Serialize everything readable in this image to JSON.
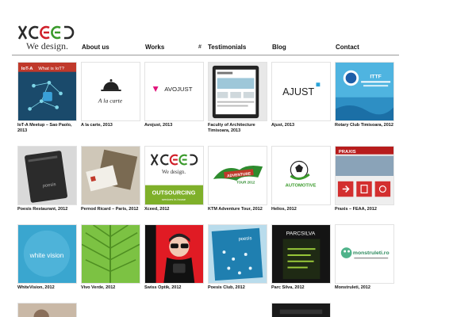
{
  "brand": {
    "logo_text": "XCEED",
    "tagline": "We design."
  },
  "nav": {
    "items": [
      "About us",
      "Works",
      "Testimonials",
      "Blog",
      "Contact"
    ],
    "separator": "#"
  },
  "colors": {
    "accent_green": "#3a9a2b",
    "accent_red": "#d0202a",
    "rule": "#9a9a9a"
  },
  "works": [
    {
      "caption": "IoT-A Meetup – Sao Paolo, 2013",
      "icon": "iot-a-meetup-thumbnail",
      "text": "What is IoT?"
    },
    {
      "caption": "A la carte, 2013",
      "icon": "a-la-carte-thumbnail",
      "text": "A la carte"
    },
    {
      "caption": "Avojust, 2013",
      "icon": "avojust-thumbnail",
      "text": "AVOJUST"
    },
    {
      "caption": "Faculty of Architecture Timisoara, 2013",
      "icon": "faculty-architecture-thumbnail",
      "text": ""
    },
    {
      "caption": "Ajust, 2013",
      "icon": "ajust-thumbnail",
      "text": "AJUST"
    },
    {
      "caption": "Rotary Club Timisoara, 2012",
      "icon": "rotary-club-thumbnail",
      "text": "ITTF"
    },
    {
      "caption": "Poesis Restaurant, 2012",
      "icon": "poesis-restaurant-thumbnail",
      "text": ""
    },
    {
      "caption": "Pernod Ricard – Paris, 2012",
      "icon": "pernod-ricard-thumbnail",
      "text": ""
    },
    {
      "caption": "Xceed, 2012",
      "icon": "xceed-thumbnail",
      "text": "OUTSOURCING"
    },
    {
      "caption": "KTM Adventure Tour, 2012",
      "icon": "ktm-adventure-thumbnail",
      "text": ""
    },
    {
      "caption": "Helios, 2012",
      "icon": "helios-thumbnail",
      "text": "AUTOMOTIVE"
    },
    {
      "caption": "Praxis – FEAA, 2012",
      "icon": "praxis-thumbnail",
      "text": "PRAXIS"
    },
    {
      "caption": "WhiteVision, 2012",
      "icon": "whitevision-thumbnail",
      "text": "white vision"
    },
    {
      "caption": "Vivo Verde, 2012",
      "icon": "vivo-verde-thumbnail",
      "text": ""
    },
    {
      "caption": "Swiss Optik, 2012",
      "icon": "swiss-optik-thumbnail",
      "text": ""
    },
    {
      "caption": "Poesis Club, 2012",
      "icon": "poesis-club-thumbnail",
      "text": ""
    },
    {
      "caption": "Parc Silva, 2012",
      "icon": "parc-silva-thumbnail",
      "text": "PARCSILVA"
    },
    {
      "caption": "Monstruleti, 2012",
      "icon": "monstruleti-thumbnail",
      "text": "monstruleti.ro"
    }
  ]
}
